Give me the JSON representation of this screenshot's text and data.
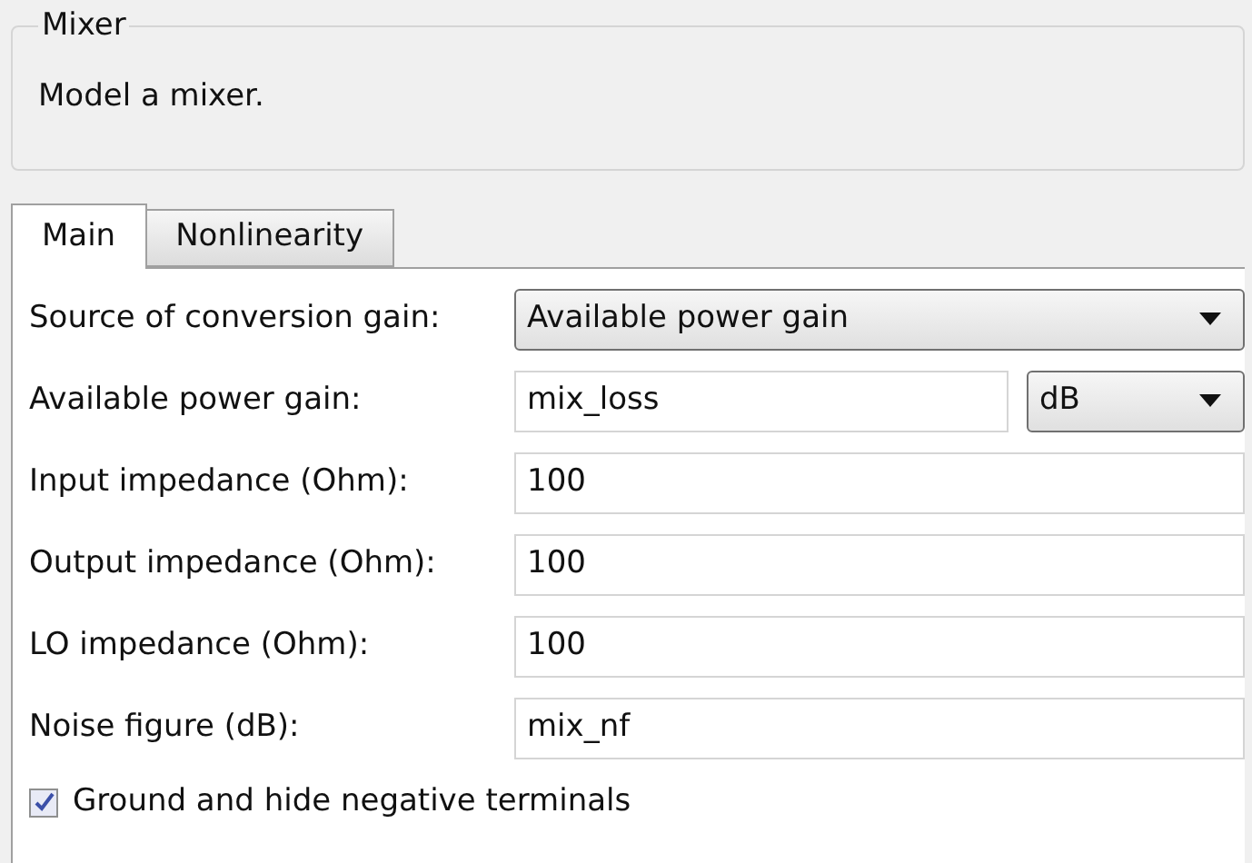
{
  "group": {
    "title": "Mixer",
    "description": "Model a mixer."
  },
  "tabs": [
    {
      "label": "Main",
      "selected": true
    },
    {
      "label": "Nonlinearity",
      "selected": false
    }
  ],
  "parameters": [
    {
      "kind": "select",
      "label": "Source of conversion gain:",
      "value": "Available power gain"
    },
    {
      "kind": "input_with_unit",
      "label": "Available power gain:",
      "value": "mix_loss",
      "unit": "dB"
    },
    {
      "kind": "input",
      "label": "Input impedance (Ohm):",
      "value": "100"
    },
    {
      "kind": "input",
      "label": "Output impedance (Ohm):",
      "value": "100"
    },
    {
      "kind": "input",
      "label": "LO impedance (Ohm):",
      "value": "100"
    },
    {
      "kind": "input",
      "label": "Noise figure (dB):",
      "value": "mix_nf"
    }
  ],
  "checkbox": {
    "label": "Ground and hide negative terminals",
    "checked": true
  }
}
